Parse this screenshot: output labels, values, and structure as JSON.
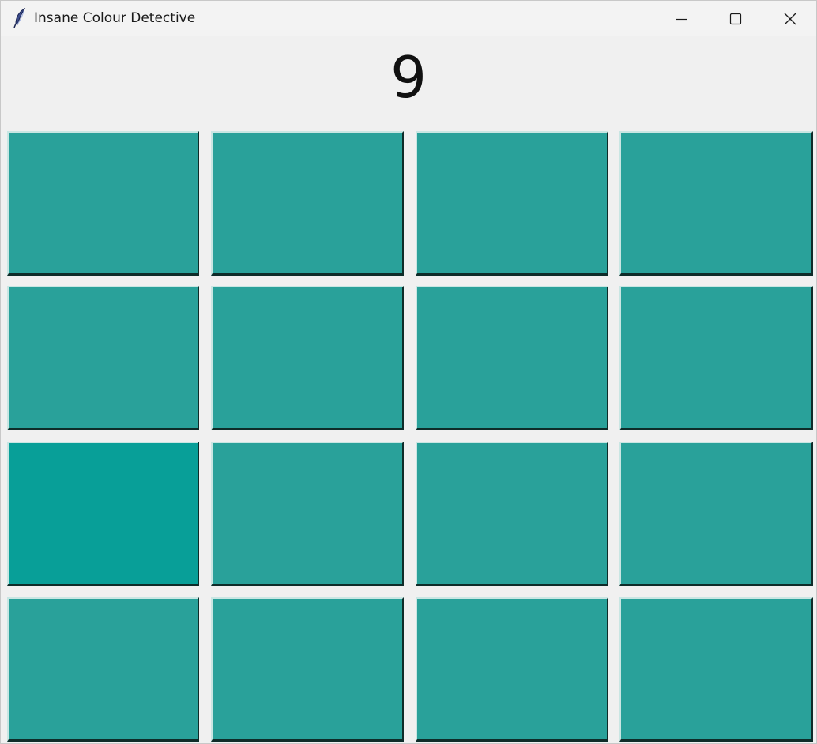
{
  "window": {
    "title": "Insane Colour Detective",
    "app_icon": "feather-icon",
    "controls": {
      "minimize_icon": "minimize-icon",
      "maximize_icon": "maximize-icon",
      "close_icon": "close-icon"
    }
  },
  "game": {
    "score": "9",
    "grid": {
      "rows": 4,
      "columns": 4,
      "base_color": "#29a19a",
      "odd_color": "#089f98",
      "odd_tile": {
        "row": 3,
        "column": 1
      }
    }
  }
}
